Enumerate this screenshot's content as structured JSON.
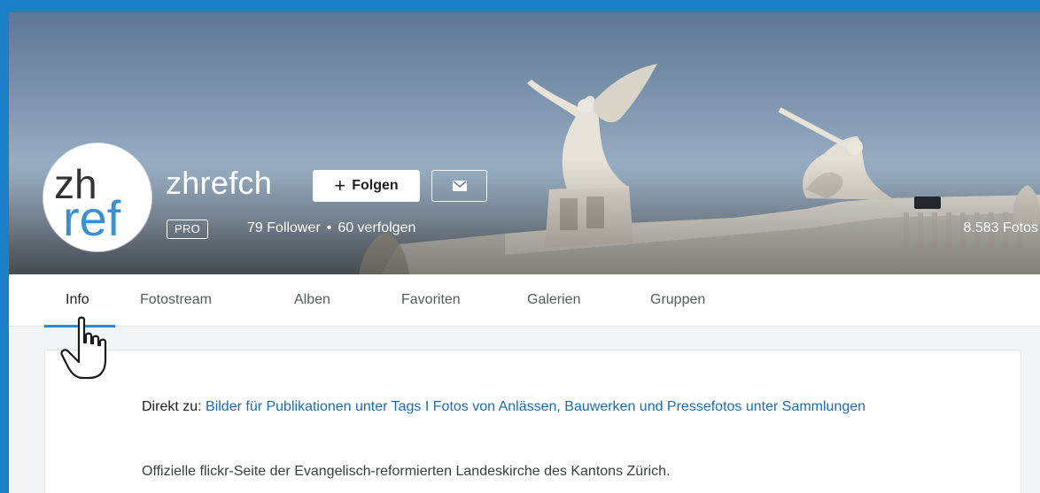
{
  "profile": {
    "username": "zhrefch",
    "avatar_text_top": "zh",
    "avatar_text_bottom": "ref",
    "follow_label": "Folgen",
    "follow_icon": "plus-icon",
    "message_icon": "envelope-icon",
    "badge": "PRO",
    "followers": "79 Follower",
    "separator": "•",
    "following": "60 verfolgen",
    "photo_count": "8.583 Fotos"
  },
  "tabs": [
    {
      "label": "Info",
      "active": true
    },
    {
      "label": "Fotostream",
      "active": false
    },
    {
      "label": "Alben",
      "active": false
    },
    {
      "label": "Favoriten",
      "active": false
    },
    {
      "label": "Galerien",
      "active": false
    },
    {
      "label": "Gruppen",
      "active": false
    }
  ],
  "about": {
    "direct_prefix": "Direkt zu: ",
    "link1": "Bilder für Publikationen unter Tags",
    "separator": " I ",
    "link2": "Fotos von Anlässen, Bauwerken und Pressefotos unter Sammlungen",
    "description": "Offizielle flickr-Seite der Evangelisch-reformierten Landeskirche des Kantons Zürich."
  },
  "colors": {
    "frame_border": "#1a7fc6",
    "accent": "#2b8ae0",
    "link": "#1f6bb0",
    "avatar_blue": "#3a8fd0"
  }
}
